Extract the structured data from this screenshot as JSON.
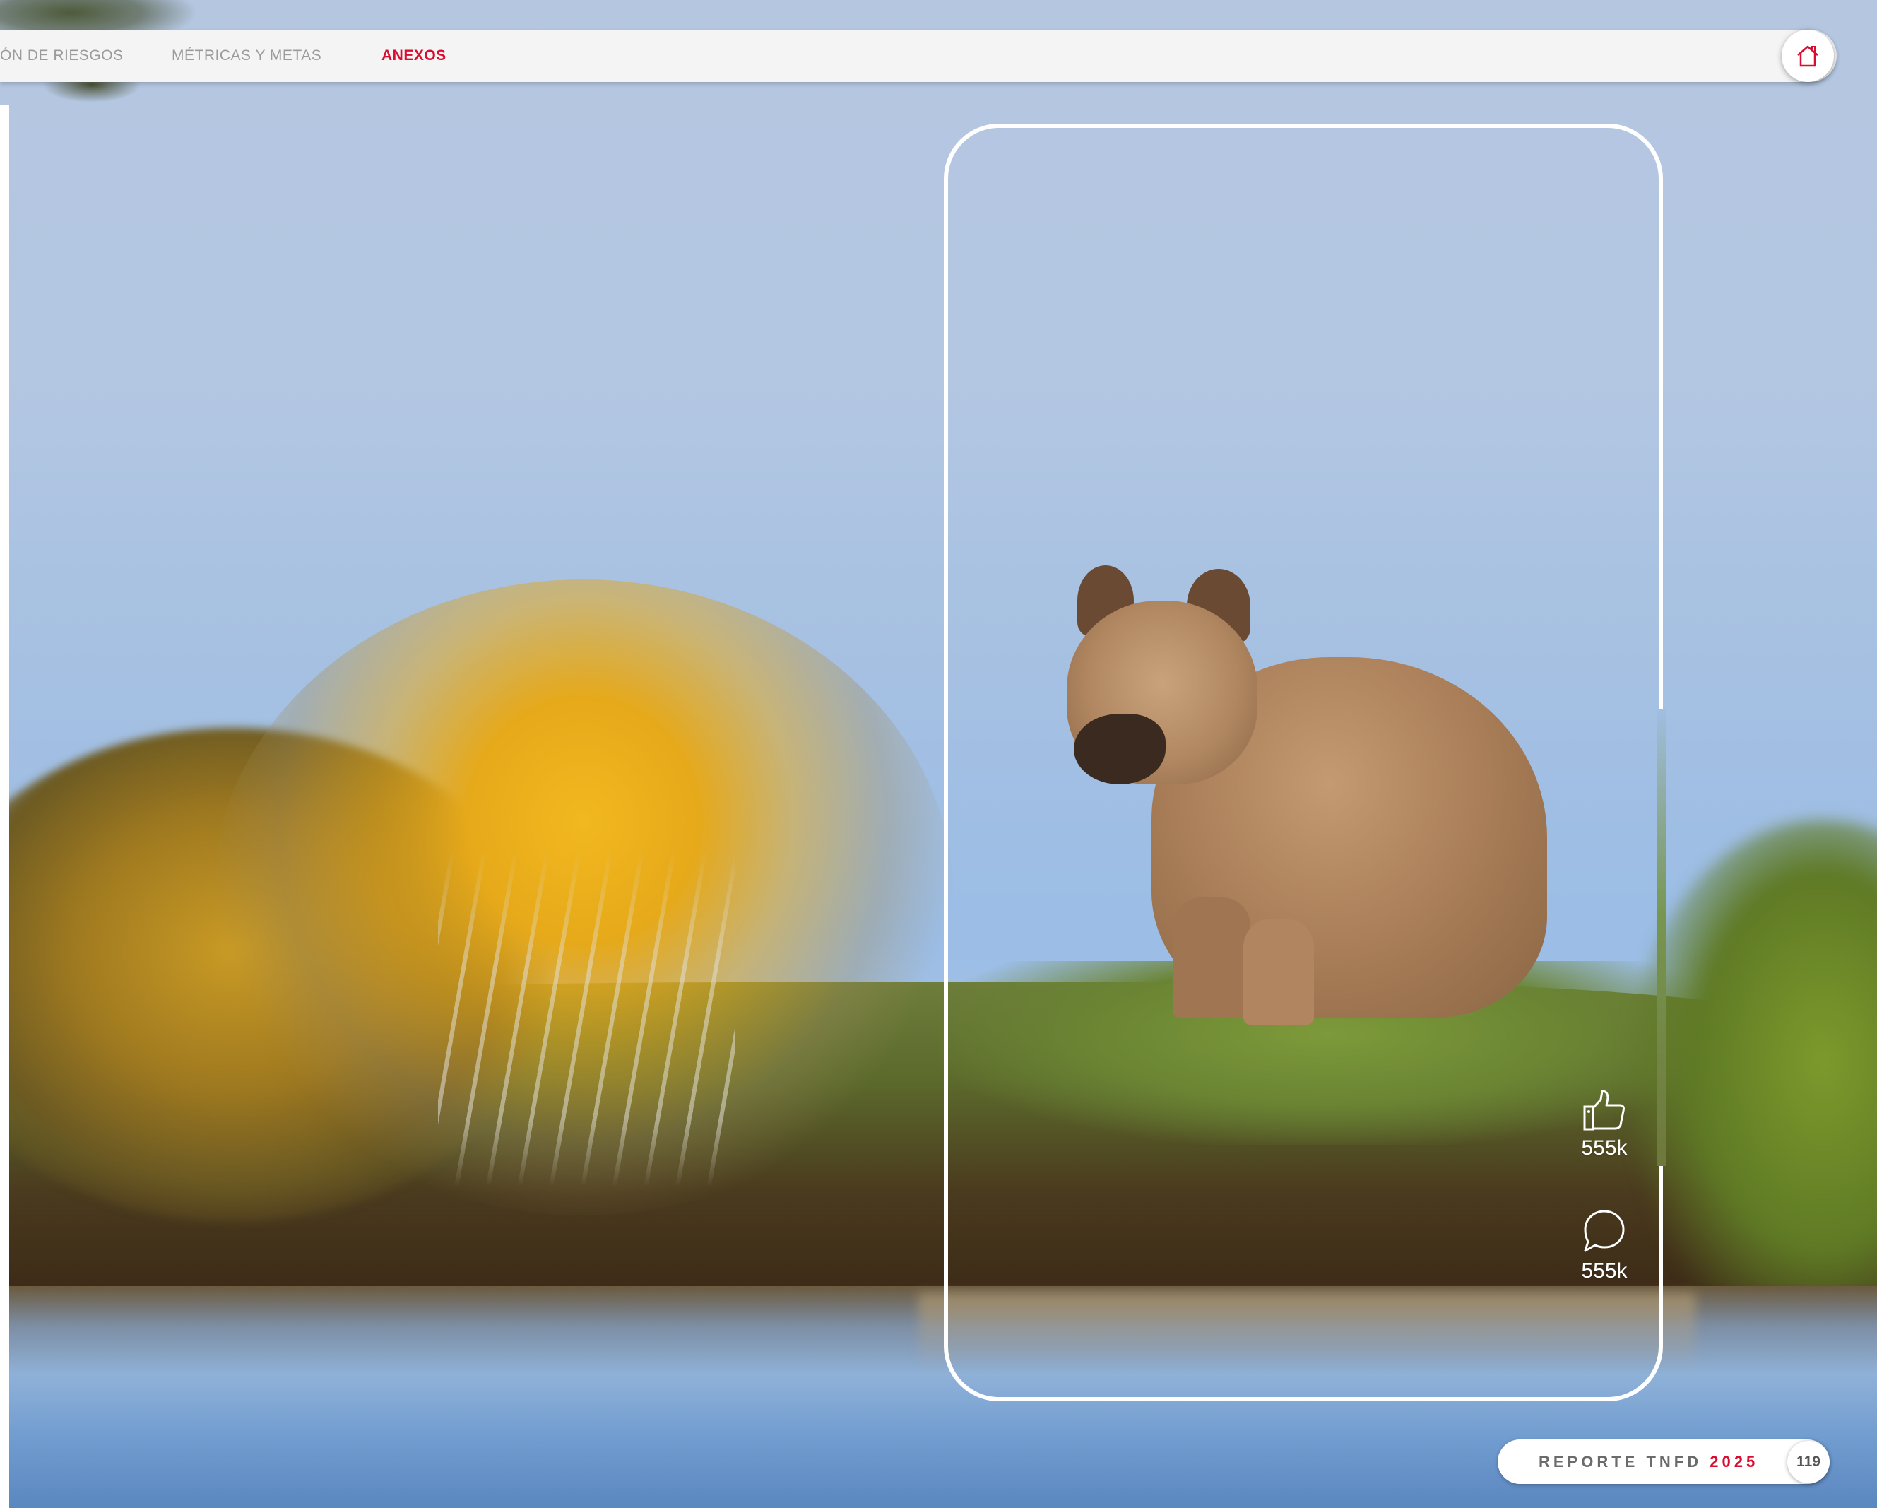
{
  "nav": {
    "items": [
      {
        "label": "ÓN DE RIESGOS"
      },
      {
        "label": "MÉTRICAS Y METAS"
      },
      {
        "label": "ANEXOS",
        "active": true
      }
    ],
    "home_icon": "home-icon"
  },
  "reactions": {
    "likes": {
      "icon": "thumbs-up-icon",
      "count": "555k"
    },
    "comments": {
      "icon": "speech-bubble-icon",
      "count": "555k"
    }
  },
  "footer": {
    "report_label": "REPORTE TNFD",
    "year": "2025",
    "page_number": "119"
  },
  "colors": {
    "accent": "#d90d2f",
    "nav_text": "#9b9b9b",
    "bar_background": "#f4f4f4"
  }
}
